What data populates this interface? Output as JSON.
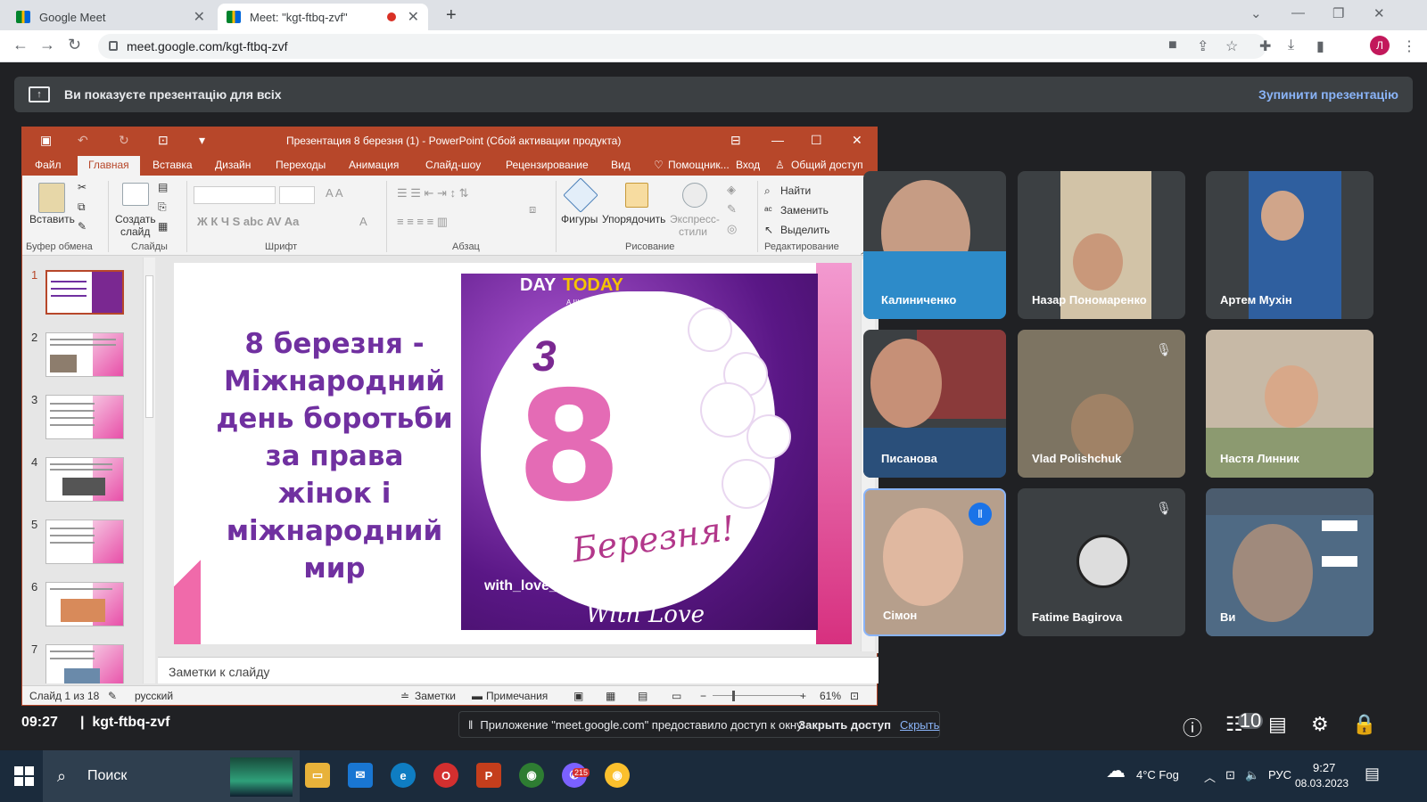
{
  "browser": {
    "tab1": "Google Meet",
    "tab2": "Meet: \"kgt-ftbq-zvf\"",
    "url": "meet.google.com/kgt-ftbq-zvf",
    "profile": "Л"
  },
  "banner": {
    "text": "Ви показуєте презентацію для всіх",
    "stop": "Зупинити презентацію"
  },
  "ppt": {
    "title": "Презентация 8 березня (1)  -  PowerPoint (Сбой активации продукта)",
    "menu": [
      "Файл",
      "Главная",
      "Вставка",
      "Дизайн",
      "Переходы",
      "Анимация",
      "Слайд-шоу",
      "Рецензирование",
      "Вид",
      "Помощник...",
      "Вход",
      "Общий доступ"
    ],
    "ribbon": {
      "paste": "Вставить",
      "create": "Создать",
      "create2": "слайд",
      "shapes": "Фигуры",
      "arrange": "Упорядочить",
      "express": "Экспресс-",
      "styles": "стили",
      "find": "Найти",
      "replace": "Заменить",
      "select": "Выделить",
      "groups": {
        "clip": "Буфер обмена",
        "slides": "Слайды",
        "font": "Шрифт",
        "para": "Абзац",
        "draw": "Рисование",
        "edit": "Редактирование"
      }
    },
    "thumbs": [
      "1",
      "2",
      "3",
      "4",
      "5",
      "6",
      "7"
    ],
    "slide": {
      "lines": [
        "8 березня -",
        "Міжнародний",
        "день боротьби",
        "за права",
        "жінок і",
        "міжнародний",
        "мир"
      ],
      "card": {
        "day": "DAY",
        "today": "TODAY",
        "sub": "А ЩО СЬОГОДНІ?",
        "three": "3",
        "eight": "8",
        "berez": "Березня!",
        "wlc": "with_love_card",
        "wl": "With Love"
      }
    },
    "notes": "Заметки к слайду",
    "status": {
      "slide": "Слайд 1 из 18",
      "lang": "русский",
      "notes": "Заметки",
      "comments": "Примечания",
      "zoom": "61%"
    }
  },
  "tiles": [
    {
      "name": "Калиниченко",
      "color": "#4a90c8"
    },
    {
      "name": "Назар Пономаренко",
      "color": "#c9b08a"
    },
    {
      "name": "Артем Мухін",
      "color": "#2d5c9a"
    },
    {
      "name": "Писанова",
      "color": "#8a3a3a"
    },
    {
      "name": "Vlad Polishchuk",
      "color": "#7d7462"
    },
    {
      "name": "Настя Линник",
      "color": "#c7b9a6"
    },
    {
      "name": "Сімон",
      "color": "#b69f8c"
    },
    {
      "name": "Fatime Bagirova",
      "color": "#3c4043"
    },
    {
      "name": "Ви",
      "color": "#4b5c6e"
    }
  ],
  "bottom": {
    "time": "09:27",
    "code": "kgt-ftbq-zvf",
    "count": "10"
  },
  "sharebar": {
    "text": "Приложение \"meet.google.com\" предоставило доступ к окну.",
    "close": "Закрыть доступ",
    "hide": "Скрыть"
  },
  "taskbar": {
    "search": "Поиск",
    "weather": "4°C  Fog",
    "lang": "РУС",
    "time": "9:27",
    "date": "08.03.2023",
    "chrome_badge": "215"
  }
}
